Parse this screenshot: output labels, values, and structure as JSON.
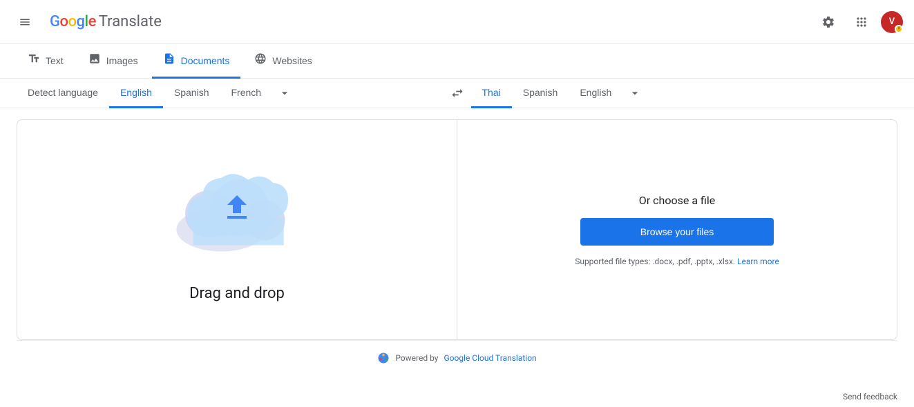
{
  "app": {
    "title": "Google Translate",
    "logo_google": "Google",
    "logo_translate": "Translate"
  },
  "header": {
    "menu_icon": "menu",
    "settings_icon": "gear",
    "apps_icon": "apps-grid",
    "avatar_text": "V",
    "avatar_badge": "!"
  },
  "tabs": [
    {
      "id": "text",
      "label": "Text",
      "icon": "text-icon",
      "active": false
    },
    {
      "id": "images",
      "label": "Images",
      "icon": "image-icon",
      "active": false
    },
    {
      "id": "documents",
      "label": "Documents",
      "icon": "document-icon",
      "active": true
    },
    {
      "id": "websites",
      "label": "Websites",
      "icon": "globe-icon",
      "active": false
    }
  ],
  "source_languages": [
    {
      "id": "detect",
      "label": "Detect language",
      "active": false
    },
    {
      "id": "english",
      "label": "English",
      "active": true
    },
    {
      "id": "spanish",
      "label": "Spanish",
      "active": false
    },
    {
      "id": "french",
      "label": "French",
      "active": false
    }
  ],
  "target_languages": [
    {
      "id": "thai",
      "label": "Thai",
      "active": true
    },
    {
      "id": "spanish",
      "label": "Spanish",
      "active": false
    },
    {
      "id": "english",
      "label": "English",
      "active": false
    }
  ],
  "main": {
    "drag_drop_label": "Drag and drop",
    "or_choose_label": "Or choose a file",
    "browse_button_label": "Browse your files",
    "supported_text": "Supported file types: .docx, .pdf, .pptx, .xlsx.",
    "learn_more_label": "Learn more"
  },
  "footer": {
    "powered_by_text": "Powered by",
    "powered_by_link_label": "Google Cloud Translation"
  },
  "send_feedback": {
    "label": "Send feedback"
  }
}
